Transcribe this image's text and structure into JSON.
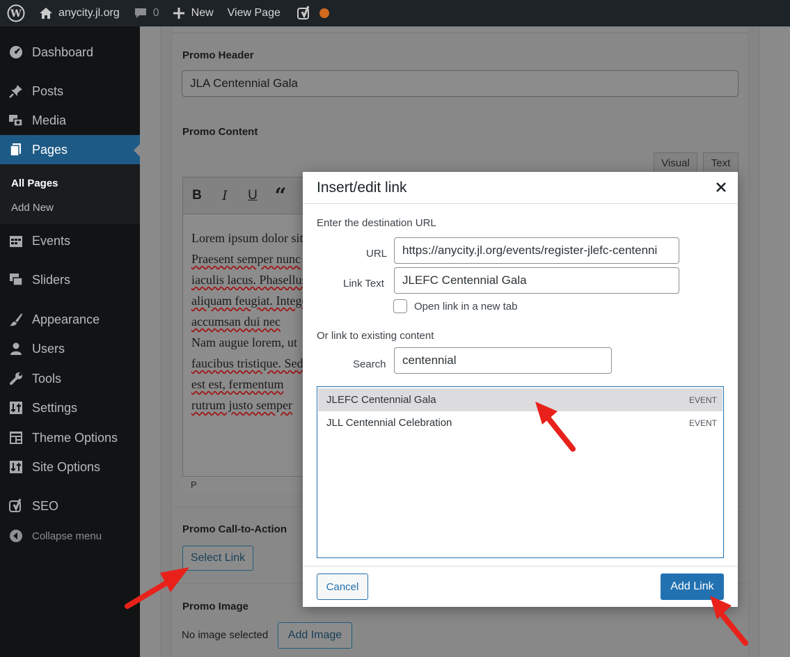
{
  "adminbar": {
    "site_name": "anycity.jl.org",
    "comments_count": "0",
    "new_label": "New",
    "view_page_label": "View Page"
  },
  "sidebar": {
    "items": [
      {
        "label": "Dashboard",
        "icon": "dashboard-icon"
      },
      {
        "label": "Posts",
        "icon": "pushpin-icon"
      },
      {
        "label": "Media",
        "icon": "media-icon"
      },
      {
        "label": "Pages",
        "icon": "pages-icon",
        "current": true
      },
      {
        "label": "Events",
        "icon": "calendar-icon"
      },
      {
        "label": "Sliders",
        "icon": "slides-icon"
      },
      {
        "label": "Appearance",
        "icon": "paintbrush-icon"
      },
      {
        "label": "Users",
        "icon": "users-icon"
      },
      {
        "label": "Tools",
        "icon": "wrench-icon"
      },
      {
        "label": "Settings",
        "icon": "settings-icon"
      },
      {
        "label": "Theme Options",
        "icon": "layout-icon"
      },
      {
        "label": "Site Options",
        "icon": "settings-icon"
      },
      {
        "label": "SEO",
        "icon": "yoast-icon"
      },
      {
        "label": "Collapse menu",
        "icon": "collapse-icon"
      }
    ],
    "submenu": [
      {
        "label": "All Pages",
        "current": true
      },
      {
        "label": "Add New"
      }
    ]
  },
  "page": {
    "promo_header_label": "Promo Header",
    "promo_header_value": "JLA Centennial Gala",
    "promo_content_label": "Promo Content",
    "visual_tab": "Visual",
    "text_tab": "Text",
    "toolbar": {
      "bold": "B",
      "italic": "I",
      "underline": "U",
      "quote": "“"
    },
    "editor_lines": [
      {
        "text": "Lorem ipsum dolor sit amet",
        "squiggle": false
      },
      {
        "text": "Praesent semper nunc",
        "squiggle": true
      },
      {
        "text": "iaculis lacus. Phasellus",
        "squiggle": true
      },
      {
        "text": "aliquam feugiat. Integer",
        "squiggle": true
      },
      {
        "text": "accumsan dui nec",
        "squiggle": true
      },
      {
        "text": "Nam augue lorem, ut",
        "squiggle": false
      },
      {
        "text": "faucibus tristique. Sed",
        "squiggle": true
      },
      {
        "text": "est est, fermentum",
        "squiggle": true
      },
      {
        "text": "rutrum justo semper",
        "squiggle": true
      }
    ],
    "editor_path": "P",
    "promo_cta_label": "Promo Call-to-Action",
    "select_link_label": "Select Link",
    "promo_image_label": "Promo Image",
    "no_image_text": "No image selected",
    "add_image_label": "Add Image"
  },
  "modal": {
    "title": "Insert/edit link",
    "url_section_label": "Enter the destination URL",
    "url_label": "URL",
    "url_value": "https://anycity.jl.org/events/register-jlefc-centenni",
    "link_text_label": "Link Text",
    "link_text_value": "JLEFC Centennial Gala",
    "new_tab_label": "Open link in a new tab",
    "existing_label": "Or link to existing content",
    "search_label": "Search",
    "search_value": "centennial",
    "results": [
      {
        "title": "JLEFC Centennial Gala",
        "type": "EVENT",
        "selected": true
      },
      {
        "title": "JLL Centennial Celebration",
        "type": "EVENT",
        "selected": false
      }
    ],
    "cancel_label": "Cancel",
    "add_link_label": "Add Link"
  },
  "colors": {
    "admin_bar": "#1d2327",
    "sidebar": "#111315",
    "current_menu": "#1e5a86",
    "primary_button": "#2271b1",
    "annotation_arrow": "#e8221b",
    "yoast_dot": "#d2691e"
  }
}
